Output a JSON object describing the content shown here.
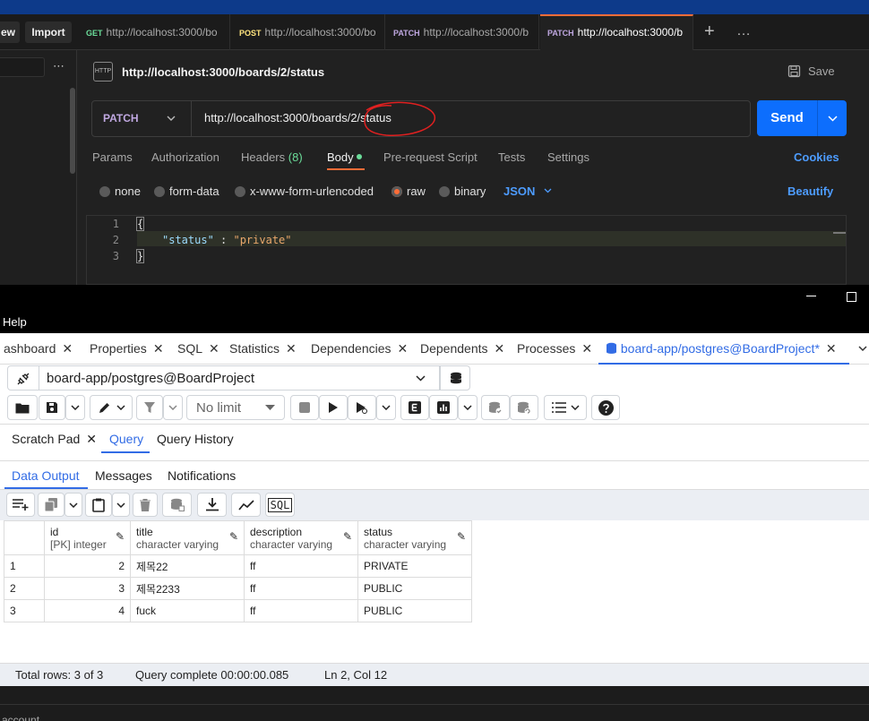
{
  "postman": {
    "tabbar": {
      "new_label": "ew",
      "import_label": "Import",
      "more": "…"
    },
    "tabs": [
      {
        "method": "GET",
        "url": "http://localhost:3000/bo",
        "color": "#6bdd9a"
      },
      {
        "method": "POST",
        "url": "http://localhost:3000/bo",
        "color": "#ffe47e"
      },
      {
        "method": "PATCH",
        "url": "http://localhost:3000/b",
        "color": "#c0a8e1"
      },
      {
        "method": "PATCH",
        "url": "http://localhost:3000/b",
        "color": "#c0a8e1"
      }
    ],
    "request_title": "http://localhost:3000/boards/2/status",
    "save_label": "Save",
    "method": "PATCH",
    "url": "http://localhost:3000/boards/2/status",
    "send_label": "Send",
    "request_tabs": [
      "Params",
      "Authorization",
      "Headers",
      "(8)",
      "Body",
      "Pre-request Script",
      "Tests",
      "Settings"
    ],
    "cookies_label": "Cookies",
    "body_types": [
      "none",
      "form-data",
      "x-www-form-urlencoded",
      "raw",
      "binary"
    ],
    "format": "JSON",
    "beautify_label": "Beautify",
    "code_lines": [
      "1",
      "2",
      "3"
    ],
    "code": {
      "open": "{",
      "key": "\"status\"",
      "sep": " : ",
      "value": "\"private\"",
      "close": "}"
    }
  },
  "pgadmin": {
    "window_controls": {
      "minimize": "–",
      "maximize": "□"
    },
    "menu_help": "Help",
    "tabs": [
      "ashboard",
      "Properties",
      "SQL",
      "Statistics",
      "Dependencies",
      "Dependents",
      "Processes",
      "board-app/postgres@BoardProject*"
    ],
    "connection": "board-app/postgres@BoardProject",
    "limit_label": "No limit",
    "editor_tabs": [
      "Scratch Pad",
      "Query",
      "Query History"
    ],
    "result_tabs": [
      "Data Output",
      "Messages",
      "Notifications"
    ],
    "sql_btn": "SQL",
    "columns": [
      {
        "name": "id",
        "type": "[PK] integer"
      },
      {
        "name": "title",
        "type": "character varying"
      },
      {
        "name": "description",
        "type": "character varying"
      },
      {
        "name": "status",
        "type": "character varying"
      }
    ],
    "rows": [
      {
        "n": "1",
        "id": "2",
        "title": "제목22",
        "description": "ff",
        "status": "PRIVATE"
      },
      {
        "n": "2",
        "id": "3",
        "title": "제목2233",
        "description": "ff",
        "status": "PUBLIC"
      },
      {
        "n": "3",
        "id": "4",
        "title": "fuck",
        "description": "ff",
        "status": "PUBLIC"
      }
    ],
    "status": {
      "total": "Total rows: 3 of 3",
      "query": "Query complete 00:00:00.085",
      "pos": "Ln 2, Col 12"
    },
    "bottom_text": "account"
  },
  "colors": {
    "accent_orange": "#ff6c37",
    "send_blue": "#0d6efd",
    "pg_blue": "#326ce5",
    "link_blue": "#4d9cff"
  }
}
